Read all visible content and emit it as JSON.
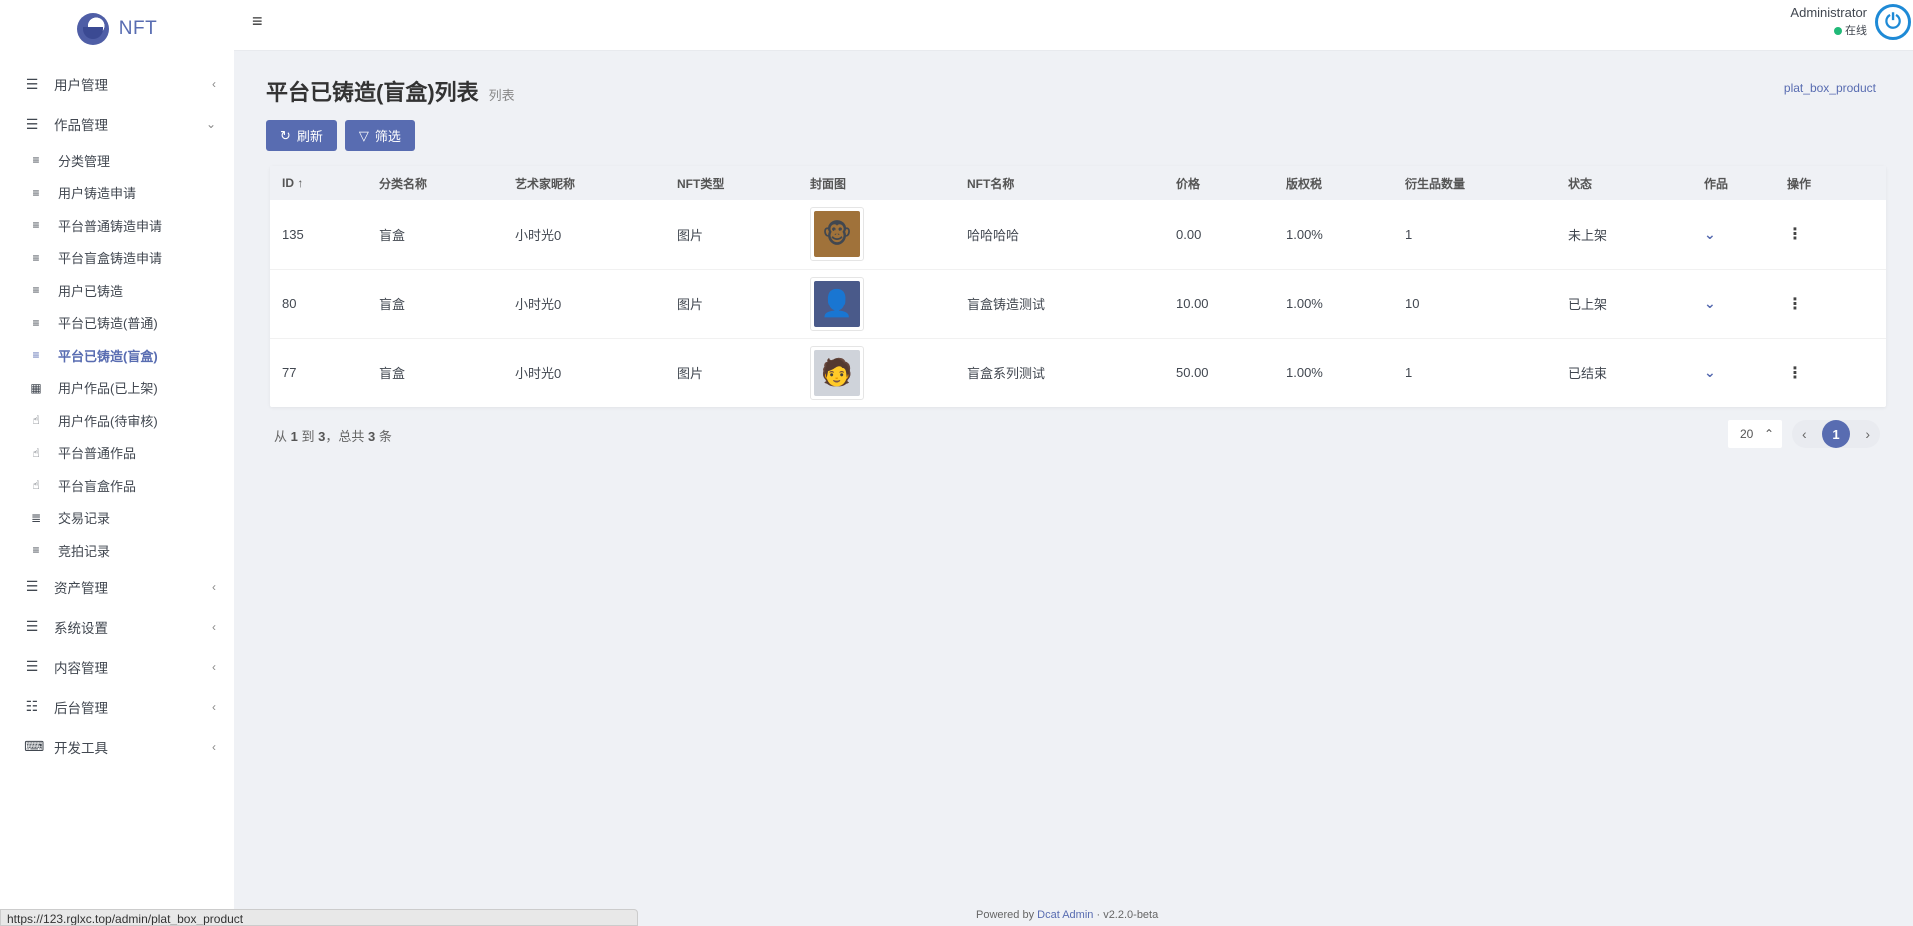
{
  "brand": {
    "name": "NFT"
  },
  "sidebar": {
    "menus": [
      {
        "icon": "list-icon",
        "glyph": "☰",
        "label": "用户管理",
        "chev": "‹"
      },
      {
        "icon": "list-icon",
        "glyph": "☰",
        "label": "作品管理",
        "chev": "⌄"
      }
    ],
    "subs": [
      {
        "icon": "align-left-icon",
        "glyph": "≡",
        "label": "分类管理"
      },
      {
        "icon": "align-left-icon",
        "glyph": "≡",
        "label": "用户铸造申请"
      },
      {
        "icon": "align-left-icon",
        "glyph": "≡",
        "label": "平台普通铸造申请"
      },
      {
        "icon": "align-left-icon",
        "glyph": "≡",
        "label": "平台盲盒铸造申请"
      },
      {
        "icon": "align-left-icon",
        "glyph": "≡",
        "label": "用户已铸造"
      },
      {
        "icon": "align-left-icon",
        "glyph": "≡",
        "label": "平台已铸造(普通)"
      },
      {
        "icon": "align-left-icon",
        "glyph": "≡",
        "label": "平台已铸造(盲盒)",
        "active": true
      },
      {
        "icon": "grid-icon",
        "glyph": "▦",
        "label": "用户作品(已上架)"
      },
      {
        "icon": "hand-icon",
        "glyph": "☝",
        "label": "用户作品(待审核)"
      },
      {
        "icon": "hand-icon",
        "glyph": "☝",
        "label": "平台普通作品"
      },
      {
        "icon": "hand-icon",
        "glyph": "☝",
        "label": "平台盲盒作品"
      },
      {
        "icon": "list-icon",
        "glyph": "≣",
        "label": "交易记录"
      },
      {
        "icon": "align-left-icon",
        "glyph": "≡",
        "label": "竞拍记录"
      }
    ],
    "bottom_menus": [
      {
        "icon": "list-icon",
        "glyph": "☰",
        "label": "资产管理",
        "chev": "‹"
      },
      {
        "icon": "list-icon",
        "glyph": "☰",
        "label": "系统设置",
        "chev": "‹"
      },
      {
        "icon": "list-icon",
        "glyph": "☰",
        "label": "内容管理",
        "chev": "‹"
      },
      {
        "icon": "server-icon",
        "glyph": "☷",
        "label": "后台管理",
        "chev": "‹"
      },
      {
        "icon": "keyboard-icon",
        "glyph": "⌨",
        "label": "开发工具",
        "chev": "‹"
      }
    ]
  },
  "topnav": {
    "toggle": "≡",
    "user_name": "Administrator",
    "user_status": "在线",
    "avatar_glyph": "⏻"
  },
  "page": {
    "title": "平台已铸造(盲盒)列表",
    "subtitle": "列表",
    "breadcrumb": "plat_box_product",
    "refresh_label": "刷新",
    "filter_label": "筛选"
  },
  "table": {
    "headers": [
      "ID ↑",
      "分类名称",
      "艺术家昵称",
      "NFT类型",
      "封面图",
      "NFT名称",
      "价格",
      "版权税",
      "衍生品数量",
      "状态",
      "作品",
      "操作"
    ],
    "rows": [
      {
        "id": "135",
        "category": "盲盒",
        "artist": "小时光0",
        "type": "图片",
        "thumb": "ape-image",
        "thumb_glyph": "🐵",
        "thumb_bg": "#a0723a",
        "name": "哈哈哈哈",
        "price": "0.00",
        "tax": "1.00%",
        "derivatives": "1",
        "status": "未上架"
      },
      {
        "id": "80",
        "category": "盲盒",
        "artist": "小时光0",
        "type": "图片",
        "thumb": "portrait-image",
        "thumb_glyph": "👤",
        "thumb_bg": "#4a5a8a",
        "name": "盲盒铸造测试",
        "price": "10.00",
        "tax": "1.00%",
        "derivatives": "10",
        "status": "已上架"
      },
      {
        "id": "77",
        "category": "盲盒",
        "artist": "小时光0",
        "type": "图片",
        "thumb": "character-image",
        "thumb_glyph": "🧑",
        "thumb_bg": "#cfd3da",
        "name": "盲盒系列测试",
        "price": "50.00",
        "tax": "1.00%",
        "derivatives": "1",
        "status": "已结束"
      }
    ]
  },
  "pagination": {
    "summary_pre": "从",
    "from": "1",
    "to_word": "到",
    "to": "3",
    "total_word": "，总共",
    "total": "3",
    "unit": "条",
    "per_page": "20",
    "current_page": "1"
  },
  "footer": {
    "powered_pre": "Powered by",
    "powered_link": "Dcat Admin",
    "version": "· v2.2.0-beta"
  },
  "statusbar": {
    "url": "https://123.rglxc.top/admin/plat_box_product"
  },
  "colors": {
    "accent": "#586cb1",
    "online": "#21b978",
    "bg": "#eff1f5"
  }
}
